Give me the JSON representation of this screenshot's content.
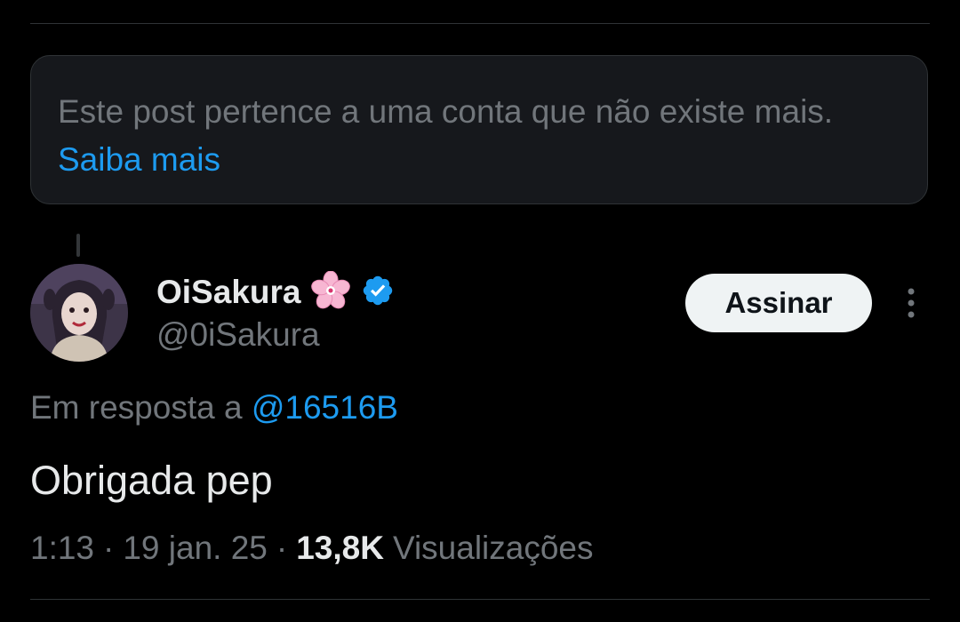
{
  "notice": {
    "text": "Este post pertence a uma conta que não existe mais.",
    "link_label": "Saiba mais"
  },
  "author": {
    "display_name": "OiSakura",
    "emoji": "🌸",
    "handle": "@0iSakura",
    "verified_icon": "verified-badge-icon"
  },
  "actions": {
    "subscribe_label": "Assinar",
    "more_icon": "more-vertical-icon"
  },
  "reply": {
    "prefix": "Em resposta a",
    "mention": "@16516B"
  },
  "tweet": {
    "text": "Obrigada pep"
  },
  "meta": {
    "time": "1:13",
    "sep1": "·",
    "date": "19 jan. 25",
    "sep2": "·",
    "views_count": "13,8K",
    "views_label": "Visualizações"
  },
  "colors": {
    "background": "#000000",
    "accent": "#1d9bf0",
    "muted": "#71767b",
    "text": "#e7e9ea",
    "card": "#16181c"
  }
}
